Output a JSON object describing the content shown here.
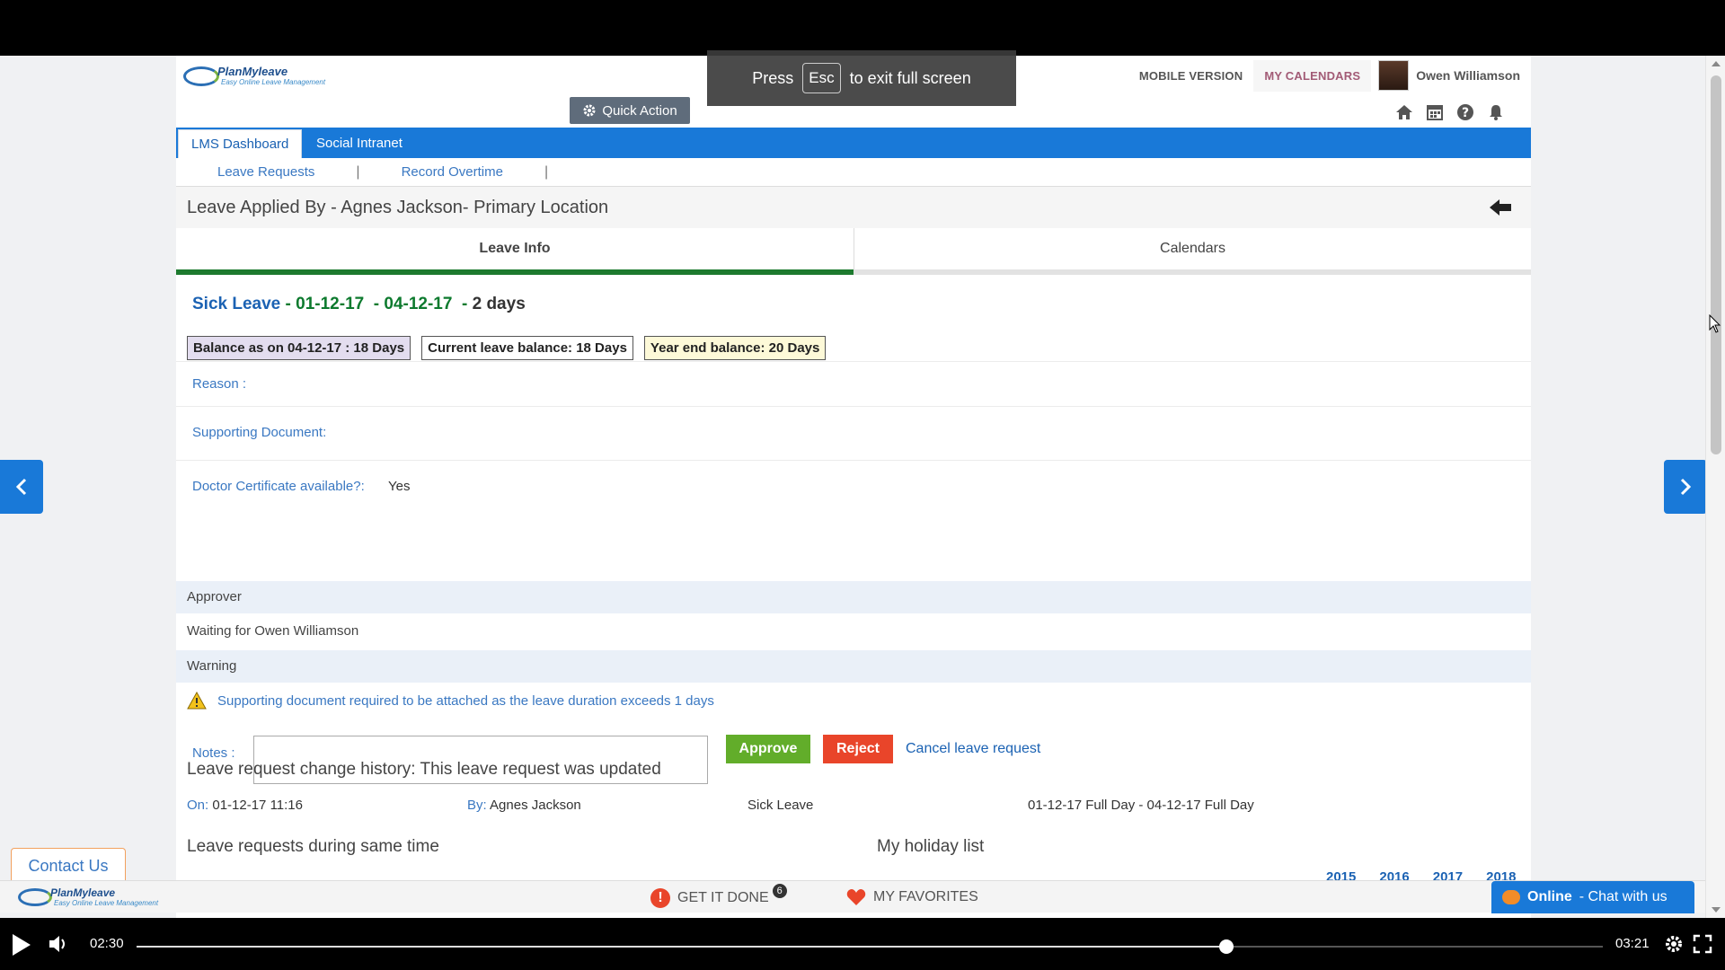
{
  "fullscreen_toast": {
    "press": "Press",
    "key": "Esc",
    "suffix": "to exit full screen"
  },
  "brand": {
    "name": "PlanMyleave",
    "tagline": "Easy Online Leave Management"
  },
  "top_links": {
    "mobile": "MOBILE VERSION",
    "calendars": "MY CALENDARS",
    "user": "Owen Williamson"
  },
  "quick_action": "Quick Action",
  "nav": {
    "tabs": [
      "LMS Dashboard",
      "Social Intranet"
    ],
    "sub": [
      "Leave Requests",
      "Record Overtime"
    ]
  },
  "title": "Leave Applied By - Agnes Jackson- Primary Location",
  "tabs": {
    "info": "Leave Info",
    "calendars": "Calendars"
  },
  "leave": {
    "type": "Sick Leave",
    "dash": "-",
    "start": "01-12-17",
    "end": "04-12-17",
    "duration": "2 days"
  },
  "badges": [
    "Balance as on 04-12-17 : 18 Days",
    "Current leave balance: 18 Days",
    "Year end balance: 20 Days"
  ],
  "fields": {
    "reason": "Reason :",
    "supporting": "Supporting Document:",
    "doctor_label": "Doctor Certificate available?:",
    "doctor_value": "Yes"
  },
  "approver": {
    "head": "Approver",
    "text": "Waiting for Owen Williamson"
  },
  "warning": {
    "head": "Warning",
    "text": "Supporting document required to be attached as the leave duration exceeds 1 days"
  },
  "actions": {
    "notes": "Notes :",
    "approve": "Approve",
    "reject": "Reject",
    "cancel": "Cancel leave request"
  },
  "history": {
    "title": "Leave request change history: This leave request was updated",
    "on_label": "On:",
    "on_value": "01-12-17 11:16",
    "by_label": "By:",
    "by_value": "Agnes Jackson",
    "type": "Sick Leave",
    "range": "01-12-17 Full Day - 04-12-17 Full Day"
  },
  "same_time_title": "Leave requests during same time",
  "holiday_title": "My holiday list",
  "years": [
    "2015",
    "2016",
    "2017",
    "2018"
  ],
  "contact": "Contact Us",
  "footer": {
    "get_it_done": "GET IT DONE",
    "get_it_done_count": "6",
    "favorites": "MY FAVORITES",
    "chat_online": "Online",
    "chat_text": "- Chat with us"
  },
  "player": {
    "current": "02:30",
    "total": "03:21",
    "progress": 0.743
  },
  "colors": {
    "nav_blue": "#1979d8",
    "approve_green": "#62ad2a",
    "reject_red": "#e9452a",
    "tab_green": "#1d7a2e"
  }
}
